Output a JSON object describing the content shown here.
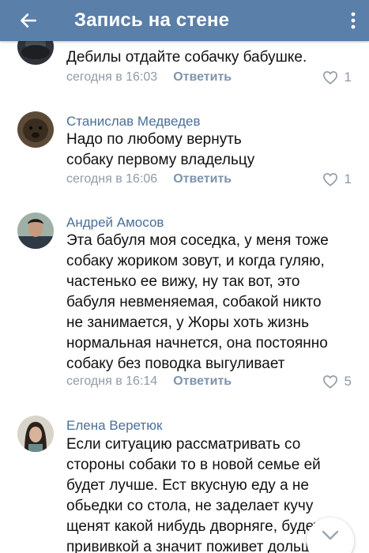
{
  "header": {
    "title": "Запись на стене",
    "back_icon": "arrow-left-icon",
    "menu_icon": "more-vertical-icon",
    "color": "#5a7fa9"
  },
  "comments": [
    {
      "author": "",
      "text": "Дебилы отдайте собачку бабушке.",
      "time": "сегодня в 16:03",
      "reply": "Ответить",
      "likes": "1"
    },
    {
      "author": "Станислав Медведев",
      "text": "Надо по любому вернуть собаку первому владельцу",
      "time": "сегодня в 16:06",
      "reply": "Ответить",
      "likes": "1"
    },
    {
      "author": "Андрей Амосов",
      "text": "Эта бабуля моя соседка, у меня тоже собаку жориком зовут, и когда гуляю, частенько ее вижу, ну так вот, это бабуля невменяемая, собакой никто не занимается, у Жоры хоть жизнь нормальная начнется, она постоянно собаку без поводка выгуливает",
      "time": "сегодня в 16:14",
      "reply": "Ответить",
      "likes": "5"
    },
    {
      "author": "Елена Веретюк",
      "text": "Если ситуацию рассматривать со стороны собаки то в новой семье ей будет лучше. Ест вкусную еду а не обьедки со стола, не заделает кучу щенят какой нибудь дворняге, будет с прививкой а значит поживет дольше",
      "time": "",
      "reply": "",
      "likes": ""
    }
  ],
  "icons": {
    "like": "heart-outline-icon",
    "scroll": "chevron-down-icon"
  }
}
